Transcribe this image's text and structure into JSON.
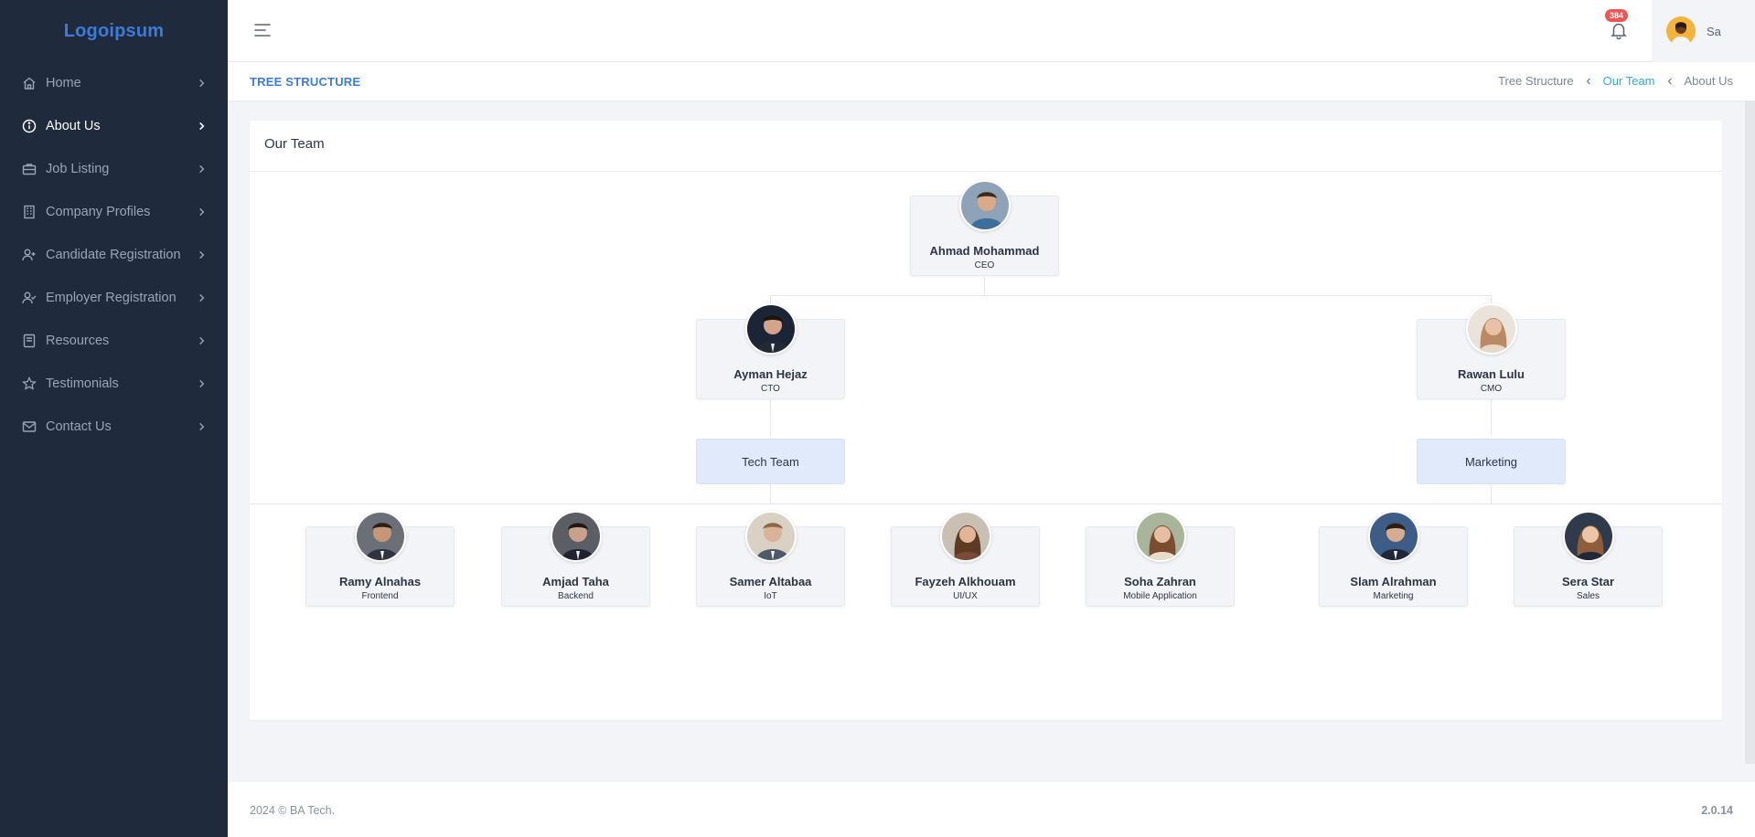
{
  "brand": {
    "logo_text": "Logoipsum"
  },
  "sidebar": {
    "items": [
      {
        "label": "Home",
        "icon": "home-icon"
      },
      {
        "label": "About Us",
        "icon": "info-icon",
        "active": true
      },
      {
        "label": "Job Listing",
        "icon": "briefcase-icon"
      },
      {
        "label": "Company Profiles",
        "icon": "building-icon"
      },
      {
        "label": "Candidate Registration",
        "icon": "user-plus-icon"
      },
      {
        "label": "Employer Registration",
        "icon": "user-check-icon"
      },
      {
        "label": "Resources",
        "icon": "book-icon"
      },
      {
        "label": "Testimonials",
        "icon": "star-icon"
      },
      {
        "label": "Contact Us",
        "icon": "mail-icon"
      }
    ]
  },
  "header": {
    "notification_count": "384",
    "user_name": "Sa"
  },
  "page": {
    "title": "TREE STRUCTURE",
    "breadcrumb": [
      "Tree Structure",
      "Our Team",
      "About Us"
    ]
  },
  "card": {
    "title": "Our Team"
  },
  "org": {
    "ceo": {
      "name": "Ahmad Mohammad",
      "role": "CEO"
    },
    "cto": {
      "name": "Ayman Hejaz",
      "role": "CTO"
    },
    "cmo": {
      "name": "Rawan Lulu",
      "role": "CMO"
    },
    "tech_group": "Tech Team",
    "marketing_group": "Marketing",
    "members": [
      {
        "name": "Ramy Alnahas",
        "role": "Frontend"
      },
      {
        "name": "Amjad Taha",
        "role": "Backend"
      },
      {
        "name": "Samer Altabaa",
        "role": "IoT"
      },
      {
        "name": "Fayzeh Alkhouam",
        "role": "UI/UX"
      },
      {
        "name": "Soha Zahran",
        "role": "Mobile Application"
      },
      {
        "name": "Slam Alrahman",
        "role": "Marketing"
      },
      {
        "name": "Sera Star",
        "role": "Sales"
      }
    ]
  },
  "footer": {
    "copyright": "2024 © BA Tech.",
    "version": "2.0.14"
  },
  "colors": {
    "sidebar_bg": "#1f2a3c",
    "accent": "#3d7bdb",
    "breadcrumb_active": "#35a7d6",
    "badge": "#f05454"
  }
}
